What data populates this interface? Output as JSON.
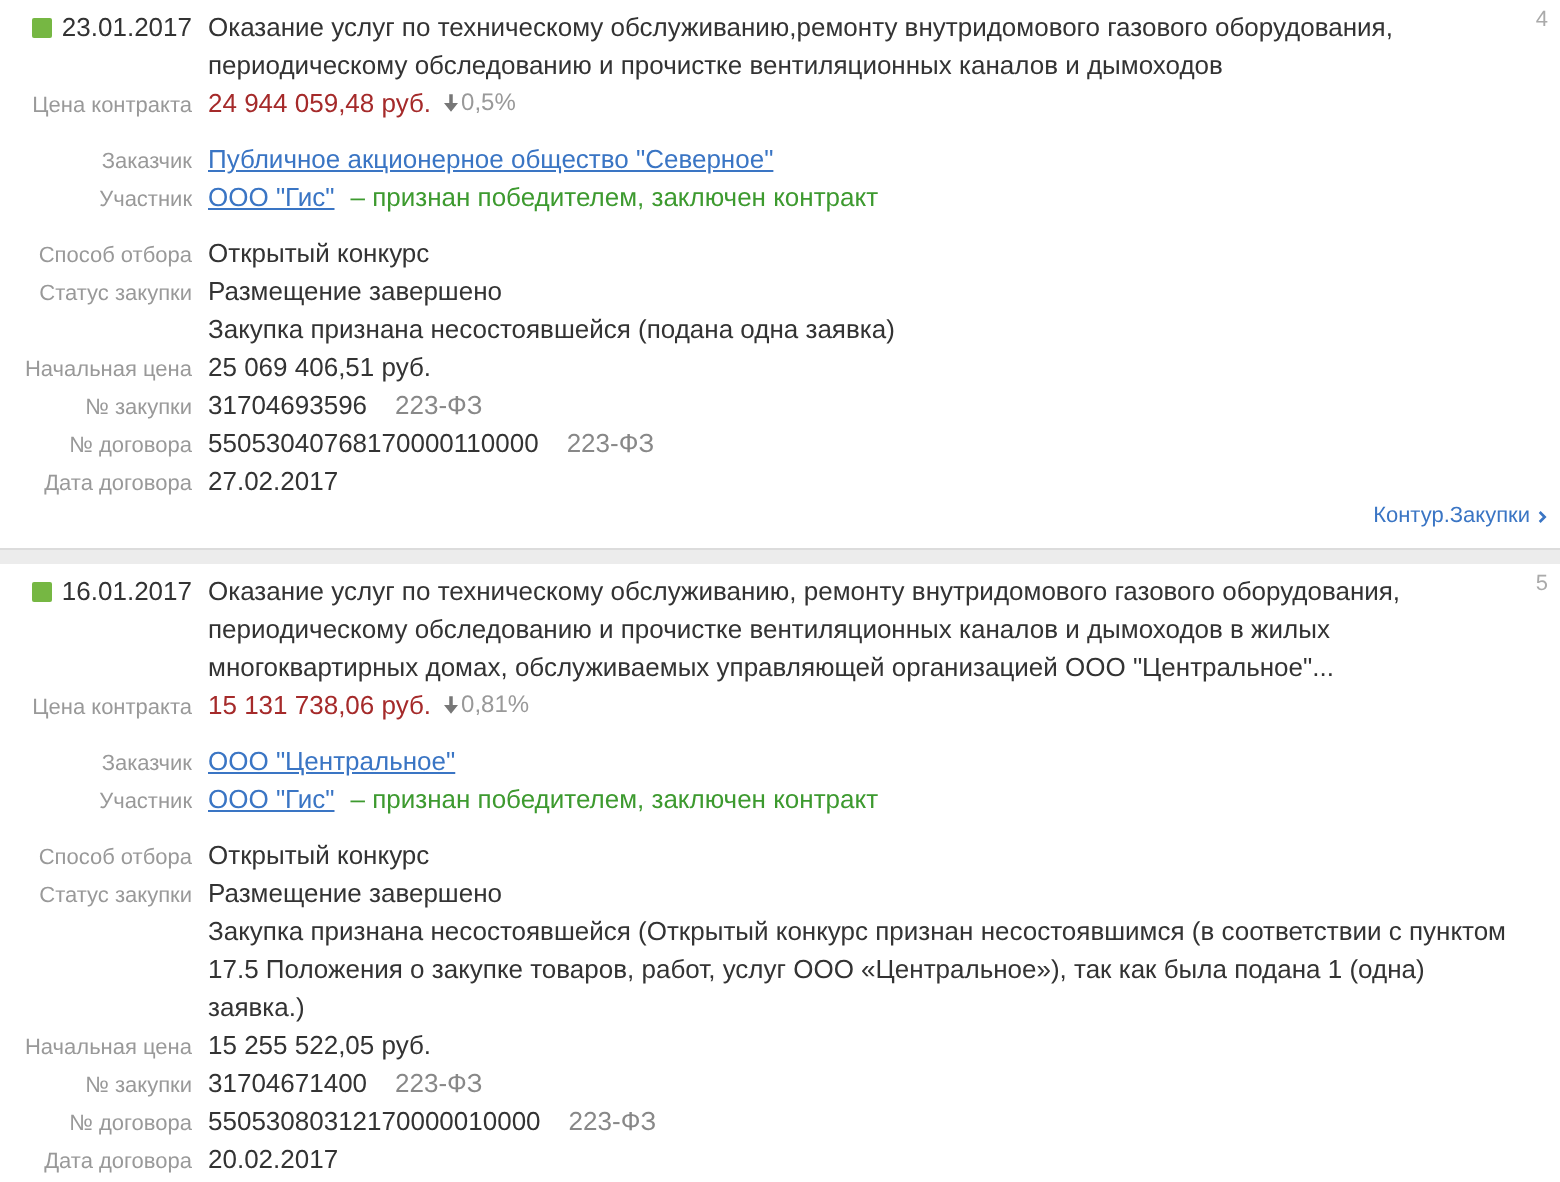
{
  "cards": [
    {
      "number": "4",
      "color": "#76b743",
      "date": "23.01.2017",
      "title": "Оказание услуг по техническому обслуживанию,ремонту внутридомового газового оборудования, периодическому обследованию и прочистке вентиляционных каналов и дымоходов",
      "price": {
        "label": "Цена контракта",
        "amount": "24 944 059,48 руб.",
        "change": "0,5%"
      },
      "customer": {
        "label": "Заказчик",
        "name": "Публичное акционерное общество \"Северное\""
      },
      "participant": {
        "label": "Участник",
        "name": "ООО \"Гис\"",
        "result": "– признан победителем, заключен контракт"
      },
      "details": [
        {
          "label": "Способ отбора",
          "value": "Открытый конкурс"
        },
        {
          "label": "Статус закупки",
          "value": "Размещение завершено"
        },
        {
          "value": "Закупка признана несостоявшейся (подана одна заявка)"
        },
        {
          "label": "Начальная цена",
          "value": "25 069 406,51 руб."
        },
        {
          "label": "№ закупки",
          "value": "31704693596",
          "law": "223-ФЗ"
        },
        {
          "label": "№ договора",
          "value": "55053040768170000110000",
          "law": "223-ФЗ"
        },
        {
          "label": "Дата договора",
          "value": "27.02.2017"
        }
      ],
      "source": "Контур.Закупки"
    },
    {
      "number": "5",
      "color": "#76b743",
      "date": "16.01.2017",
      "title": "Оказание услуг по техническому обслуживанию, ремонту внутридомового газового оборудования, периодическому обследованию и прочистке вентиляционных каналов и дымоходов в жилых многоквартирных домах, обслуживаемых управляющей организацией ООО \"Центральное\"...",
      "price": {
        "label": "Цена контракта",
        "amount": "15 131 738,06 руб.",
        "change": "0,81%"
      },
      "customer": {
        "label": "Заказчик",
        "name": "ООО \"Центральное\""
      },
      "participant": {
        "label": "Участник",
        "name": "ООО \"Гис\"",
        "result": "– признан победителем, заключен контракт"
      },
      "details": [
        {
          "label": "Способ отбора",
          "value": "Открытый конкурс"
        },
        {
          "label": "Статус закупки",
          "value": "Размещение завершено"
        },
        {
          "value": "Закупка признана несостоявшейся (Открытый конкурс признан несостоявшимся (в соответствии с пунктом 17.5 Положения о закупке товаров, работ, услуг ООО «Центральное»), так как была подана 1 (одна) заявка.)"
        },
        {
          "label": "Начальная цена",
          "value": "15 255 522,05 руб."
        },
        {
          "label": "№ закупки",
          "value": "31704671400",
          "law": "223-ФЗ"
        },
        {
          "label": "№ договора",
          "value": "55053080312170000010000",
          "law": "223-ФЗ"
        },
        {
          "label": "Дата договора",
          "value": "20.02.2017"
        }
      ]
    }
  ]
}
